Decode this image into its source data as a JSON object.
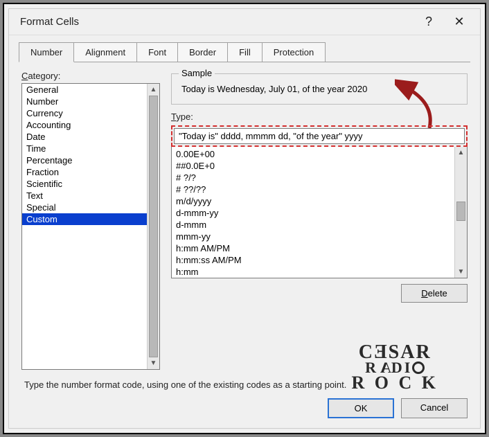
{
  "titlebar": {
    "title": "Format Cells",
    "help": "?",
    "close": "✕"
  },
  "tabs": [
    {
      "label": "Number",
      "active": true
    },
    {
      "label": "Alignment",
      "active": false
    },
    {
      "label": "Font",
      "active": false
    },
    {
      "label": "Border",
      "active": false
    },
    {
      "label": "Fill",
      "active": false
    },
    {
      "label": "Protection",
      "active": false
    }
  ],
  "category": {
    "label": "Category:",
    "items": [
      {
        "label": "General",
        "selected": false
      },
      {
        "label": "Number",
        "selected": false
      },
      {
        "label": "Currency",
        "selected": false
      },
      {
        "label": "Accounting",
        "selected": false
      },
      {
        "label": "Date",
        "selected": false
      },
      {
        "label": "Time",
        "selected": false
      },
      {
        "label": "Percentage",
        "selected": false
      },
      {
        "label": "Fraction",
        "selected": false
      },
      {
        "label": "Scientific",
        "selected": false
      },
      {
        "label": "Text",
        "selected": false
      },
      {
        "label": "Special",
        "selected": false
      },
      {
        "label": "Custom",
        "selected": true
      }
    ]
  },
  "sample": {
    "legend": "Sample",
    "text": "Today is Wednesday, July 01, of the year 2020"
  },
  "type": {
    "label": "Type:",
    "value": "\"Today is\" dddd, mmmm dd, \"of the year\" yyyy",
    "options": [
      "0.00E+00",
      "##0.0E+0",
      "# ?/?",
      "# ??/??",
      "m/d/yyyy",
      "d-mmm-yy",
      "d-mmm",
      "mmm-yy",
      "h:mm AM/PM",
      "h:mm:ss AM/PM",
      "h:mm"
    ]
  },
  "buttons": {
    "delete": "Delete",
    "ok": "OK",
    "cancel": "Cancel"
  },
  "hint": "Type the number format code, using one of the existing codes as a starting point.",
  "watermark": {
    "l1": "CƎSAR",
    "l2": "RADIO",
    "l3": "ROCK"
  }
}
